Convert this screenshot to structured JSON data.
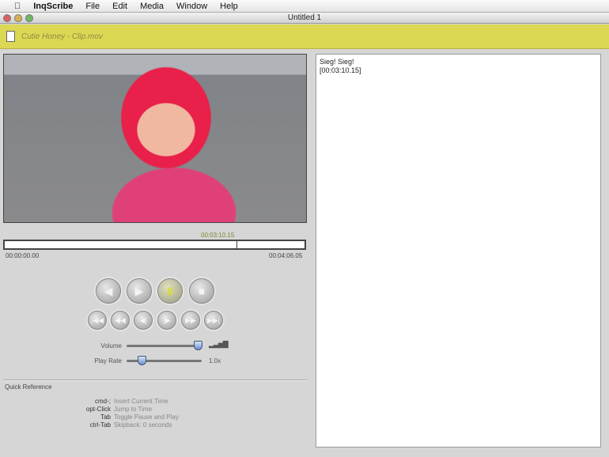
{
  "menubar": {
    "app": "InqScribe",
    "items": [
      "File",
      "Edit",
      "Media",
      "Window",
      "Help"
    ]
  },
  "window": {
    "title": "Untitled 1"
  },
  "file": {
    "name": "Cutie Honey - Clip.mov"
  },
  "timeline": {
    "current": "00:03:10.15",
    "start": "00:00:00.00",
    "end": "00:04:06.05",
    "progress": 0.774
  },
  "controls": {
    "volume_label": "Volume",
    "rate_label": "Play Rate",
    "rate_value": "1.0x",
    "volume": 0.95,
    "rate": 0.2
  },
  "quick_reference": {
    "title": "Quick Reference",
    "items": [
      {
        "key": "cmd-;",
        "desc": "Insert Current Time"
      },
      {
        "key": "opt-Click",
        "desc": "Jump to Time"
      },
      {
        "key": "Tab",
        "desc": "Toggle Pause and Play"
      },
      {
        "key": "ctrl-Tab",
        "desc": "Skipback: 0 seconds"
      }
    ]
  },
  "transcript": {
    "lines": [
      "Sieg! Sieg!",
      "[00:03:10.15]"
    ]
  }
}
